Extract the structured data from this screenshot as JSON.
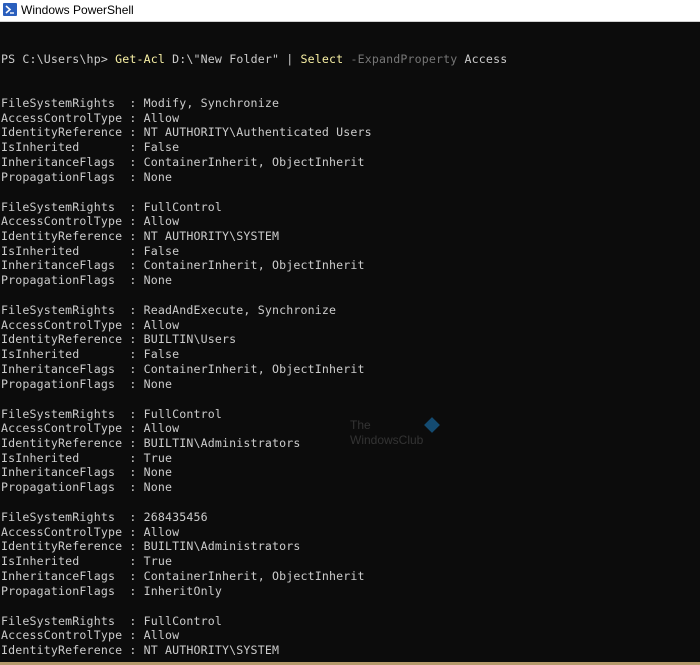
{
  "window": {
    "title": "Windows PowerShell",
    "icon": "powershell-icon"
  },
  "console": {
    "prompt": "PS C:\\Users\\hp>",
    "command": {
      "cmdlet": "Get-Acl",
      "arg": "D:\\\"New Folder\"",
      "pipe": "|",
      "select": "Select",
      "param": "-ExpandProperty",
      "value": "Access"
    },
    "entries": [
      {
        "FileSystemRights": "Modify, Synchronize",
        "AccessControlType": "Allow",
        "IdentityReference": "NT AUTHORITY\\Authenticated Users",
        "IsInherited": "False",
        "InheritanceFlags": "ContainerInherit, ObjectInherit",
        "PropagationFlags": "None"
      },
      {
        "FileSystemRights": "FullControl",
        "AccessControlType": "Allow",
        "IdentityReference": "NT AUTHORITY\\SYSTEM",
        "IsInherited": "False",
        "InheritanceFlags": "ContainerInherit, ObjectInherit",
        "PropagationFlags": "None"
      },
      {
        "FileSystemRights": "ReadAndExecute, Synchronize",
        "AccessControlType": "Allow",
        "IdentityReference": "BUILTIN\\Users",
        "IsInherited": "False",
        "InheritanceFlags": "ContainerInherit, ObjectInherit",
        "PropagationFlags": "None"
      },
      {
        "FileSystemRights": "FullControl",
        "AccessControlType": "Allow",
        "IdentityReference": "BUILTIN\\Administrators",
        "IsInherited": "True",
        "InheritanceFlags": "None",
        "PropagationFlags": "None"
      },
      {
        "FileSystemRights": "268435456",
        "AccessControlType": "Allow",
        "IdentityReference": "BUILTIN\\Administrators",
        "IsInherited": "True",
        "InheritanceFlags": "ContainerInherit, ObjectInherit",
        "PropagationFlags": "InheritOnly"
      },
      {
        "FileSystemRights": "FullControl",
        "AccessControlType": "Allow",
        "IdentityReference": "NT AUTHORITY\\SYSTEM"
      }
    ],
    "labels": {
      "FileSystemRights": "FileSystemRights  : ",
      "AccessControlType": "AccessControlType : ",
      "IdentityReference": "IdentityReference : ",
      "IsInherited": "IsInherited       : ",
      "InheritanceFlags": "InheritanceFlags  : ",
      "PropagationFlags": "PropagationFlags  : "
    }
  },
  "watermark": {
    "line1": "The",
    "line2": "WindowsClub"
  },
  "colors": {
    "background": "#0c0c0c",
    "text": "#cccccc",
    "cmdlet": "#f9f1a5",
    "parameter": "#767676"
  }
}
